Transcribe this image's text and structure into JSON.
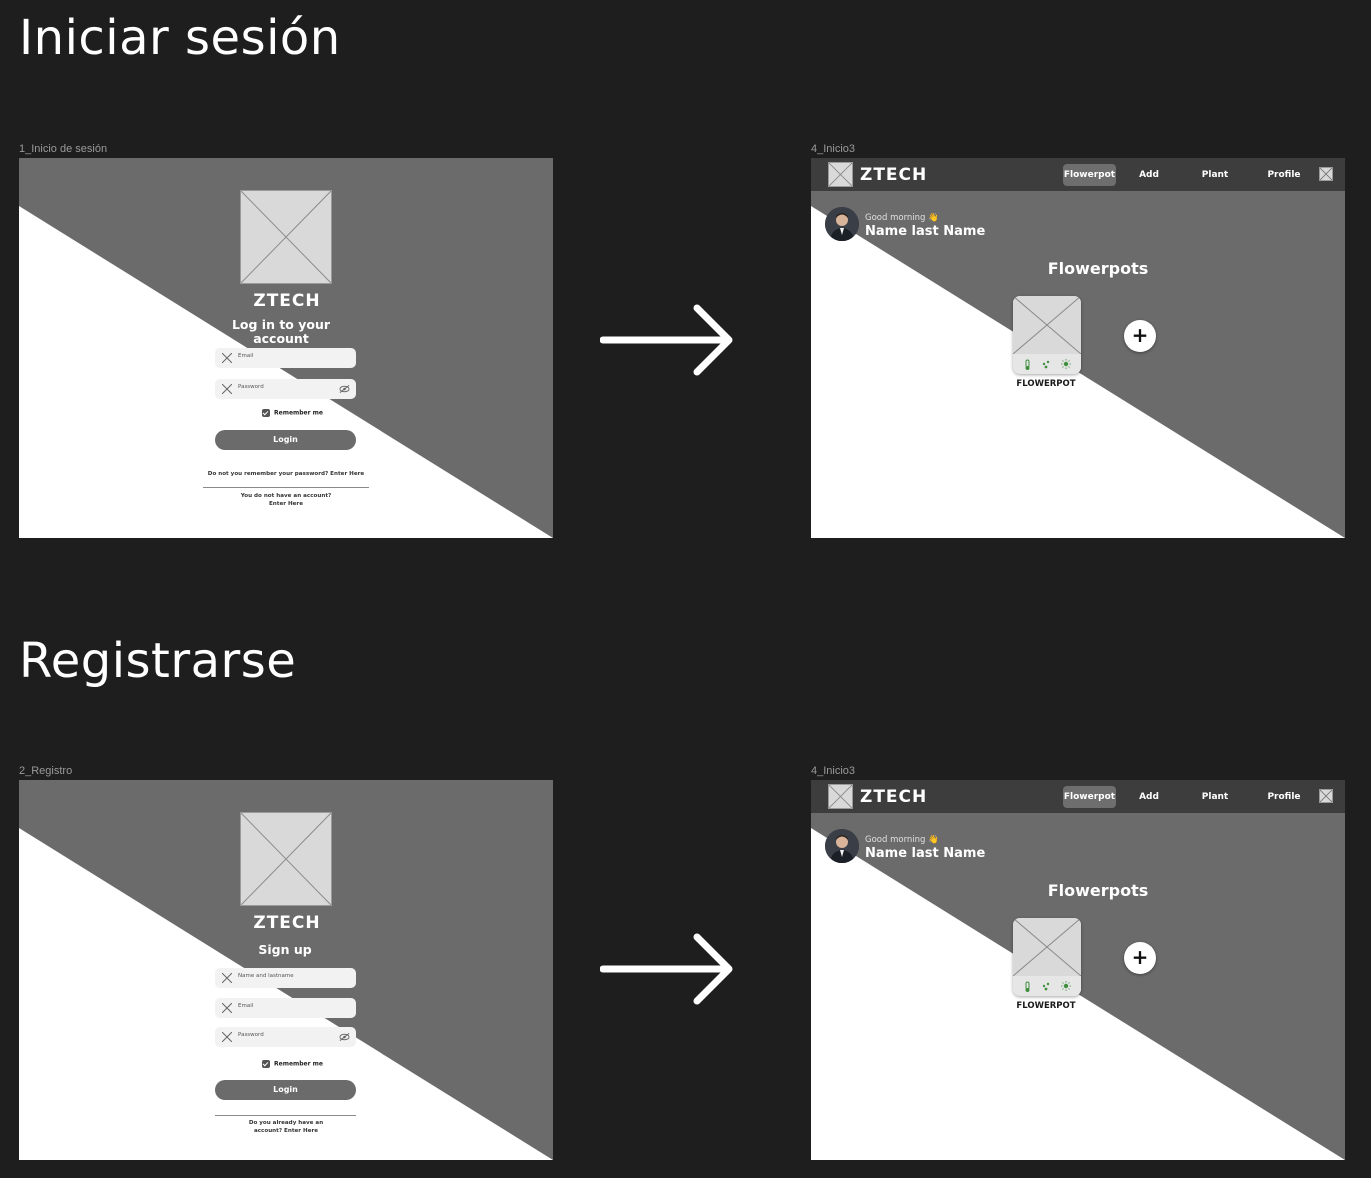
{
  "sections": {
    "login_title": "Iniciar sesión",
    "register_title": "Registrarse"
  },
  "frames": {
    "login_label": "1_Inicio de sesión",
    "home1_label": "4_Inicio3",
    "register_label": "2_Registro",
    "home2_label": "4_Inicio3"
  },
  "brand": {
    "logo": "ZTECH"
  },
  "login": {
    "heading": "Log in to your account",
    "email_placeholder": "Email",
    "password_placeholder": "Password",
    "remember": "Remember me",
    "button": "Login",
    "forgot": "Do not you remember your password? Enter Here",
    "no_account_line1": "You do not have an account?",
    "no_account_line2": "Enter Here"
  },
  "register": {
    "heading": "Sign up",
    "name_placeholder": "Name and lastname",
    "email_placeholder": "Email",
    "password_placeholder": "Password",
    "remember": "Remember me",
    "button": "Login",
    "have_account_line1": "Do you already have an",
    "have_account_line2": "account? Enter Here"
  },
  "home": {
    "nav": [
      "Flowerpot",
      "Add",
      "Plant",
      "Profile"
    ],
    "active_nav": "Flowerpot",
    "greeting": "Good morning 👋",
    "user_name": "Name last Name",
    "title": "Flowerpots",
    "card_label": "FLOWERPOT",
    "add_symbol": "+"
  },
  "colors": {
    "canvas": "#1e1e1e",
    "frame_dark": "#6b6b6b",
    "frame_light": "#ffffff",
    "topbar": "#3d3d3d",
    "placeholder": "#d9d9d9",
    "sensor_green": "#3f8f3f"
  },
  "icons": [
    "arrow-right-icon",
    "placeholder-x-icon",
    "eye-icon",
    "checkbox-icon",
    "thermometer-icon",
    "water-drops-icon",
    "sun-icon",
    "plus-icon"
  ]
}
